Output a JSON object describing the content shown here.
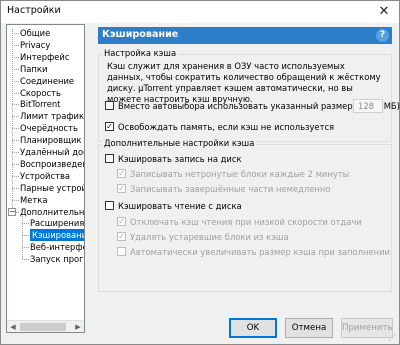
{
  "window": {
    "title": "Настройки",
    "close_glyph": "✕"
  },
  "tree": {
    "items": [
      {
        "label": "Общие"
      },
      {
        "label": "Privacy"
      },
      {
        "label": "Интерфейс"
      },
      {
        "label": "Папки"
      },
      {
        "label": "Соединение"
      },
      {
        "label": "Скорость"
      },
      {
        "label": "BitTorrent"
      },
      {
        "label": "Лимит трафика"
      },
      {
        "label": "Очерёдность"
      },
      {
        "label": "Планировщик"
      },
      {
        "label": "Удалённый доступ"
      },
      {
        "label": "Воспроизведение"
      },
      {
        "label": "Устройства"
      },
      {
        "label": "Парные устройства"
      },
      {
        "label": "Метка"
      },
      {
        "label": "Дополнительно",
        "expander": "−"
      },
      {
        "label": "Расширения интерфейса"
      },
      {
        "label": "Кэширование",
        "selected": true
      },
      {
        "label": "Веб-интерфейс"
      },
      {
        "label": "Запуск программ"
      }
    ],
    "scroll_left": "◀",
    "scroll_right": "▶"
  },
  "header": {
    "title": "Кэширование",
    "help": "?"
  },
  "cache_settings": {
    "title": "Настройка кэша",
    "description": "Кэш служит для хранения в ОЗУ часто используемых данных, чтобы сократить количество обращений к жёсткому диску. µTorrent управляет кэшем автоматически, но вы можете настроить кэш вручную.",
    "override_label": "Вместо автовыбора использовать указанный размер кэша (МБ)",
    "override_checked": false,
    "size_value": "128",
    "free_memory_label": "Освобождать память, если кэш не используется",
    "free_memory_checked": true
  },
  "advanced": {
    "title": "Дополнительные настройки кэша",
    "write_label": "Кэшировать запись на диск",
    "write_checked": false,
    "write_opt1": "Записывать нетронутые блоки каждые 2 минуты",
    "write_opt1_checked": true,
    "write_opt2": "Записывать завершённые части немедленно",
    "write_opt2_checked": true,
    "read_label": "Кэшировать чтение с диска",
    "read_checked": false,
    "read_opt1": "Отключать кэш чтения при низкой скорости отдачи",
    "read_opt1_checked": true,
    "read_opt2": "Удалять устаревшие блоки из кэша",
    "read_opt2_checked": true,
    "read_opt3": "Автоматически увеличивать размер кэша при заполнении",
    "read_opt3_checked": false
  },
  "buttons": {
    "ok": "OK",
    "cancel": "Отмена",
    "apply": "Применить"
  }
}
